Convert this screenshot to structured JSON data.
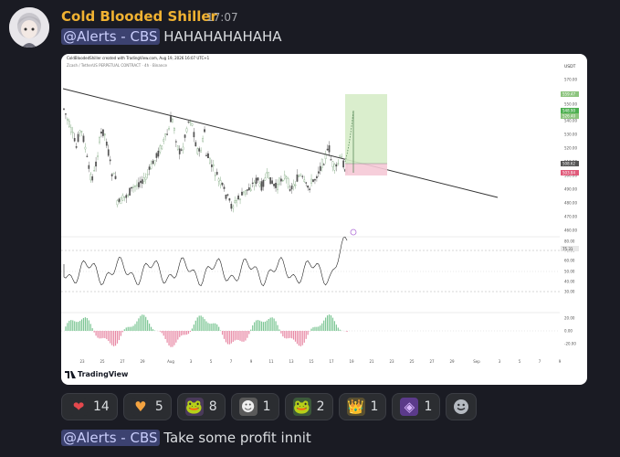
{
  "message": {
    "username": "Cold Blooded Shiller",
    "timestamp": "17:07",
    "mention": "@Alerts - CBS",
    "text": "HAHAHAHAHAHA"
  },
  "embed": {
    "tv_caption": "ColdBloodedShiller created with TradingView.com, Aug 19, 2026 16:07 UTC+1",
    "tv_subcaption": "Zcash / TetherUS PERPETUAL CONTRACT · 4h · Binance",
    "tv_logo": "TradingView",
    "currency": "USDT",
    "price_badges": [
      "559.47",
      "548.90",
      "526.40"
    ],
    "mid_badges": [
      "508.62",
      "503.84"
    ],
    "osc_badge": "75.31"
  },
  "chart_data": {
    "type": "line",
    "x_labels": [
      "23",
      "25",
      "27",
      "29",
      "Aug",
      "3",
      "5",
      "7",
      "9",
      "11",
      "13",
      "15",
      "17",
      "19",
      "21",
      "23",
      "25",
      "27",
      "29",
      "Sep",
      "3",
      "5",
      "7",
      "9"
    ],
    "price_ticks": [
      "570.00",
      "550.00",
      "540.00",
      "530.00",
      "520.00",
      "510.00",
      "500.00",
      "490.00",
      "480.00",
      "470.00",
      "460.00"
    ],
    "rsi_ticks": [
      "80.00",
      "70.00",
      "60.00",
      "50.00",
      "40.00",
      "30.00"
    ],
    "macd_ticks": [
      "20.00",
      "0.00",
      "-20.00"
    ]
  },
  "reactions": [
    {
      "name": "heart-red",
      "emoji": "❤",
      "bg": "#2b2d31",
      "color": "#e5484d",
      "count": "14"
    },
    {
      "name": "heart-orange",
      "emoji": "♥",
      "bg": "#2b2d31",
      "color": "#f4a340",
      "count": "5"
    },
    {
      "name": "pepe-gun",
      "emoji": "🐸",
      "bg": "#4a3a5a",
      "color": "#7ed07a",
      "count": "8"
    },
    {
      "name": "meme-face",
      "emoji": "☻",
      "bg": "#5a5a5a",
      "color": "#eee",
      "count": "1"
    },
    {
      "name": "pepe-smug",
      "emoji": "🐸",
      "bg": "#3c5a3a",
      "color": "#8bc77a",
      "count": "2"
    },
    {
      "name": "pepe-king",
      "emoji": "👑",
      "bg": "#5a5030",
      "color": "#e0c040",
      "count": "1"
    },
    {
      "name": "purple-bot",
      "emoji": "◈",
      "bg": "#5b3a8a",
      "color": "#d9b6ff",
      "count": "1"
    }
  ],
  "second_message": {
    "mention": "@Alerts - CBS",
    "text": "Take some profit innit"
  }
}
